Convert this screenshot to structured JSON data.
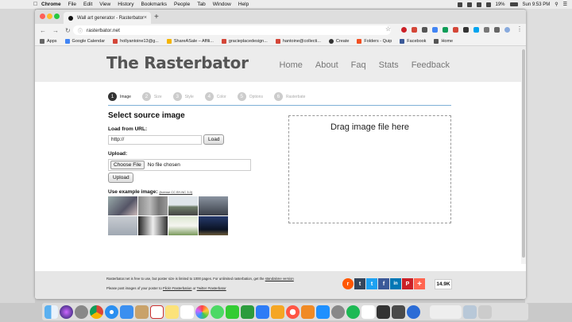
{
  "menubar": {
    "app": "Chrome",
    "items": [
      "File",
      "Edit",
      "View",
      "History",
      "Bookmarks",
      "People",
      "Tab",
      "Window",
      "Help"
    ],
    "battery": "19%",
    "clock": "Sun 9:53 PM"
  },
  "browser": {
    "tab_title": "Wall art generator - Rasterbator",
    "url": "rasterbator.net",
    "bookmarks": [
      {
        "label": "Apps",
        "color": "#666666"
      },
      {
        "label": "Google Calendar",
        "color": "#4285f4"
      },
      {
        "label": "hollyantoine13@g...",
        "color": "#d44638"
      },
      {
        "label": "ShareASale – Affili...",
        "color": "#f5b400"
      },
      {
        "label": "gracieplacedesign...",
        "color": "#d44638"
      },
      {
        "label": "hantoine@collecti...",
        "color": "#d44638"
      },
      {
        "label": "Create",
        "color": "#333333"
      },
      {
        "label": "Folders - Quip",
        "color": "#f25022"
      },
      {
        "label": "Facebook",
        "color": "#3b5998"
      },
      {
        "label": "Home",
        "color": "#555555"
      }
    ]
  },
  "site": {
    "logo": "The Rasterbator",
    "nav": [
      "Home",
      "About",
      "Faq",
      "Stats",
      "Feedback"
    ],
    "steps": [
      {
        "num": "1",
        "label": "Image"
      },
      {
        "num": "2",
        "label": "Size"
      },
      {
        "num": "3",
        "label": "Style"
      },
      {
        "num": "4",
        "label": "Color"
      },
      {
        "num": "5",
        "label": "Options"
      },
      {
        "num": "6",
        "label": "Rasterbate"
      }
    ],
    "source": {
      "heading": "Select source image",
      "url_label": "Load from URL:",
      "url_value": "http://",
      "load_button": "Load",
      "upload_label": "Upload:",
      "choose_button": "Choose File",
      "no_file": "No file chosen",
      "upload_button": "Upload",
      "examples_label": "Use example image:",
      "license": "(license CC BY-NC 3.0)"
    },
    "dropzone": "Drag image file here",
    "footer": {
      "line1_a": "Rasterbator.net is free to use, but poster size is limited to 1000 pages. For unlimited rasterbation, get the",
      "line1_link": "standalone version",
      "line2_a": "Please post images of your poster to",
      "line2_link1": "Flickr #rasterbation",
      "line2_mid": "or",
      "line2_link2": "Twitter #rasterbator",
      "share_count": "14.9K"
    },
    "share_buttons": [
      {
        "icon": "reddit-icon",
        "glyph": "r",
        "color": "#ff5700"
      },
      {
        "icon": "tumblr-icon",
        "glyph": "t",
        "color": "#35465c"
      },
      {
        "icon": "twitter-icon",
        "glyph": "t",
        "color": "#1da1f2"
      },
      {
        "icon": "facebook-icon",
        "glyph": "f",
        "color": "#3b5998"
      },
      {
        "icon": "linkedin-icon",
        "glyph": "in",
        "color": "#0077b5"
      },
      {
        "icon": "pinterest-icon",
        "glyph": "P",
        "color": "#cb2027"
      },
      {
        "icon": "more-share-icon",
        "glyph": "+",
        "color": "#ff6550"
      }
    ]
  }
}
